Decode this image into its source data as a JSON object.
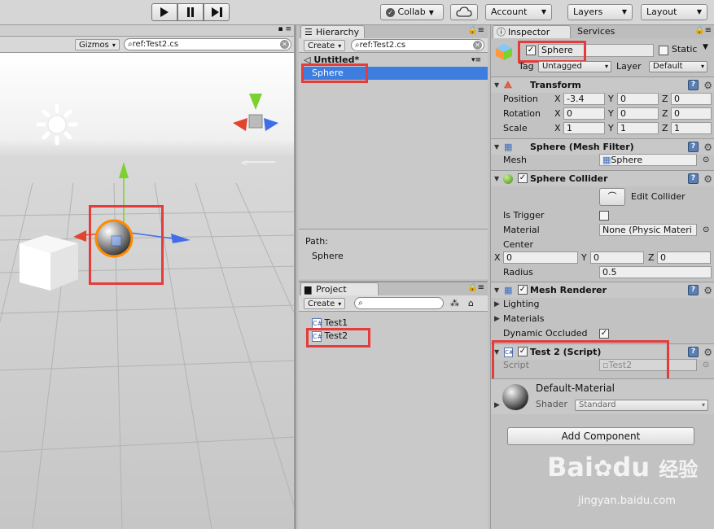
{
  "toolbar": {
    "collab": "Collab",
    "account": "Account",
    "layers": "Layers",
    "layout": "Layout"
  },
  "scene": {
    "gizmos": "Gizmos",
    "search": "ref:Test2.cs"
  },
  "hierarchy": {
    "tab": "Hierarchy",
    "create": "Create",
    "search": "ref:Test2.cs",
    "scene_name": "Untitled*",
    "selected_item": "Sphere",
    "path_label": "Path:",
    "path_value": "Sphere"
  },
  "project": {
    "tab": "Project",
    "create": "Create",
    "items": [
      "Test1",
      "Test2"
    ]
  },
  "inspector": {
    "tab": "Inspector",
    "services_tab": "Services",
    "object_name": "Sphere",
    "static_label": "Static",
    "tag_label": "Tag",
    "tag_value": "Untagged",
    "layer_label": "Layer",
    "layer_value": "Default",
    "transform": {
      "title": "Transform",
      "position_label": "Position",
      "position": [
        "-3.4",
        "0",
        "0"
      ],
      "rotation_label": "Rotation",
      "rotation": [
        "0",
        "0",
        "0"
      ],
      "scale_label": "Scale",
      "scale": [
        "1",
        "1",
        "1"
      ],
      "axes": [
        "X",
        "Y",
        "Z"
      ]
    },
    "mesh_filter": {
      "title": "Sphere (Mesh Filter)",
      "mesh_label": "Mesh",
      "mesh_value": "Sphere"
    },
    "collider": {
      "title": "Sphere Collider",
      "edit_label": "Edit Collider",
      "is_trigger_label": "Is Trigger",
      "material_label": "Material",
      "material_value": "None (Physic Materi",
      "center_label": "Center",
      "center": [
        "0",
        "0",
        "0"
      ],
      "radius_label": "Radius",
      "radius_value": "0.5"
    },
    "renderer": {
      "title": "Mesh Renderer",
      "lighting": "Lighting",
      "materials": "Materials",
      "dynamic_occluded": "Dynamic Occluded"
    },
    "script": {
      "title": "Test 2 (Script)",
      "script_label": "Script",
      "script_value": "Test2"
    },
    "material": {
      "name": "Default-Material",
      "shader_label": "Shader",
      "shader_value": "Standard"
    },
    "add_component": "Add Component"
  },
  "watermark": {
    "brand": "Bai",
    "brand2": "du",
    "cn": "经验",
    "url": "jingyan.baidu.com"
  },
  "colors": {
    "selection": "#3d7de0",
    "highlight": "#e43c3c",
    "gizmo_y": "#7bd12f",
    "gizmo_x": "#3f6ee8",
    "gizmo_z": "#e2442e"
  }
}
